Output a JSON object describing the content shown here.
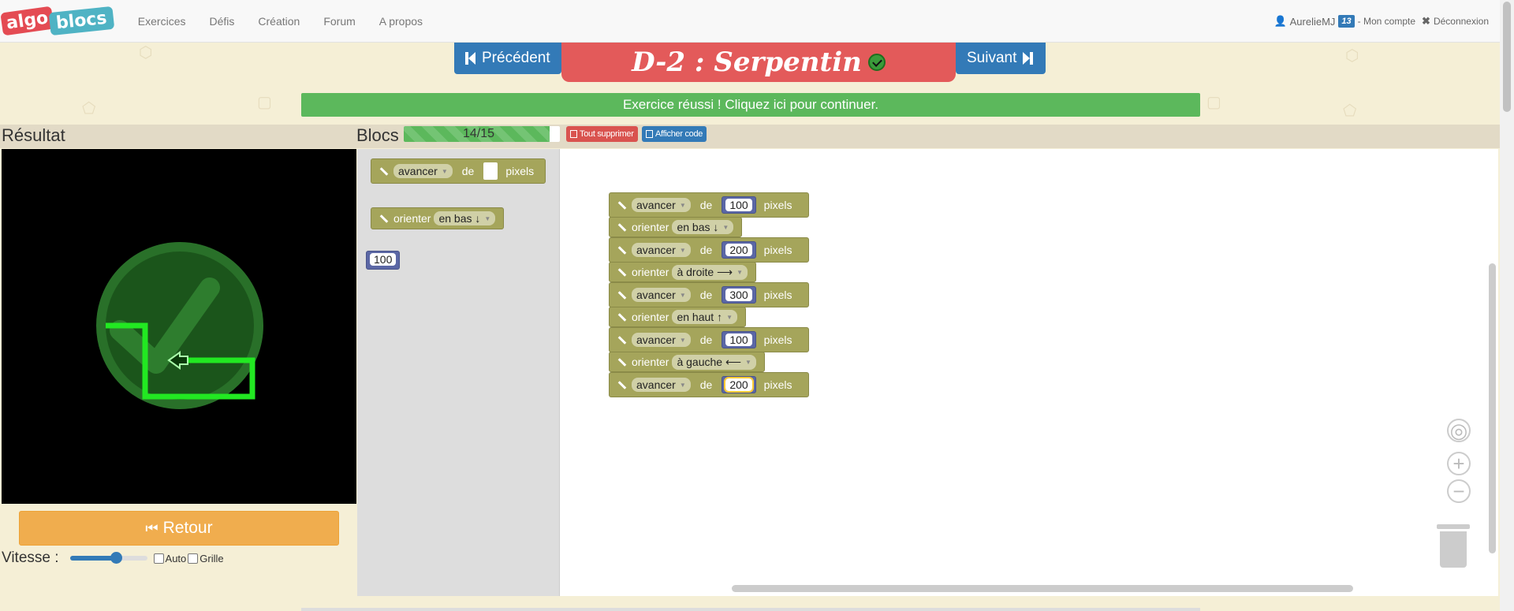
{
  "brand": {
    "part1": "algo",
    "part2": "blocs"
  },
  "nav": {
    "links": [
      "Exercices",
      "Défis",
      "Création",
      "Forum",
      "A propos"
    ],
    "user": "AurelieMJ",
    "badge": "13",
    "account": "- Mon compte",
    "logout": "Déconnexion"
  },
  "header": {
    "prev_label": "Précédent",
    "title": "D-2 : Serpentin",
    "next_label": "Suivant",
    "success_message": "Exercice réussi ! Cliquez ici pour continuer."
  },
  "panels": {
    "result_label": "Résultat",
    "blocks_label": "Blocs",
    "progress_text": "14/15",
    "progress_fraction": 0.933,
    "delete_all": "Tout supprimer",
    "show_code": "Afficher code"
  },
  "controls": {
    "back_label": "Retour",
    "speed_label": "Vitesse :",
    "speed_value": 0.6,
    "auto_label": "Auto",
    "grid_label": "Grille"
  },
  "toolbox": {
    "move_block": {
      "verb": "avancer",
      "of": "de",
      "unit": "pixels"
    },
    "orient_block": {
      "verb": "orienter",
      "direction": "en bas ↓"
    },
    "number_block": "100"
  },
  "program": [
    {
      "type": "move",
      "verb": "avancer",
      "of": "de",
      "value": "100",
      "unit": "pixels"
    },
    {
      "type": "orient",
      "verb": "orienter",
      "direction": "en bas ↓"
    },
    {
      "type": "move",
      "verb": "avancer",
      "of": "de",
      "value": "200",
      "unit": "pixels"
    },
    {
      "type": "orient",
      "verb": "orienter",
      "direction": "à droite ⟶"
    },
    {
      "type": "move",
      "verb": "avancer",
      "of": "de",
      "value": "300",
      "unit": "pixels"
    },
    {
      "type": "orient",
      "verb": "orienter",
      "direction": "en haut ↑"
    },
    {
      "type": "move",
      "verb": "avancer",
      "of": "de",
      "value": "100",
      "unit": "pixels"
    },
    {
      "type": "orient",
      "verb": "orienter",
      "direction": "à gauche ⟵"
    },
    {
      "type": "move",
      "verb": "avancer",
      "of": "de",
      "value": "200",
      "unit": "pixels",
      "selected": true
    }
  ],
  "colors": {
    "block_green": "#a5a55b",
    "number_blue": "#5b67a5",
    "success": "#5cb85c",
    "title_red": "#e35a5a",
    "primary": "#337ab7",
    "warning": "#f0ad4e"
  }
}
